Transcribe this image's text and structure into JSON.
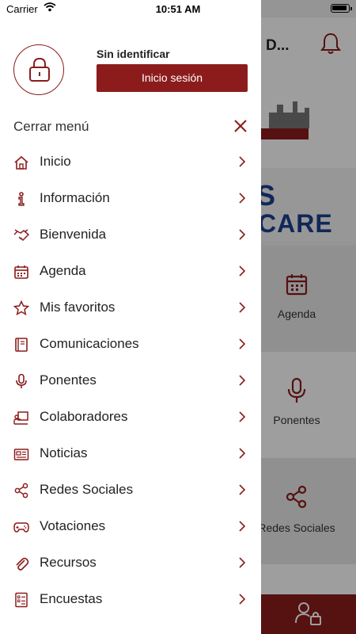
{
  "status_bar": {
    "carrier": "Carrier",
    "time": "10:51 AM"
  },
  "background": {
    "header_title": "D...",
    "banner_line1": "S",
    "banner_line2": "CARE",
    "tiles": [
      {
        "label": "Agenda",
        "icon": "calendar-icon"
      },
      {
        "label": "Ponentes",
        "icon": "microphone-icon"
      },
      {
        "label": "Redes Sociales",
        "icon": "share-icon"
      }
    ]
  },
  "drawer": {
    "user_status": "Sin identificar",
    "login_label": "Inicio sesión",
    "close_label": "Cerrar menú",
    "items": [
      {
        "label": "Inicio",
        "icon": "home-icon"
      },
      {
        "label": "Información",
        "icon": "info-icon"
      },
      {
        "label": "Bienvenida",
        "icon": "handshake-icon"
      },
      {
        "label": "Agenda",
        "icon": "calendar-icon"
      },
      {
        "label": "Mis favoritos",
        "icon": "star-icon"
      },
      {
        "label": "Comunicaciones",
        "icon": "book-icon"
      },
      {
        "label": "Ponentes",
        "icon": "microphone-icon"
      },
      {
        "label": "Colaboradores",
        "icon": "presentation-icon"
      },
      {
        "label": "Noticias",
        "icon": "newspaper-icon"
      },
      {
        "label": "Redes Sociales",
        "icon": "share-icon"
      },
      {
        "label": "Votaciones",
        "icon": "gamepad-icon"
      },
      {
        "label": "Recursos",
        "icon": "paperclip-icon"
      },
      {
        "label": "Encuestas",
        "icon": "checklist-icon"
      }
    ]
  },
  "colors": {
    "accent": "#8c1c1c",
    "banner_text": "#1b3f8f"
  }
}
